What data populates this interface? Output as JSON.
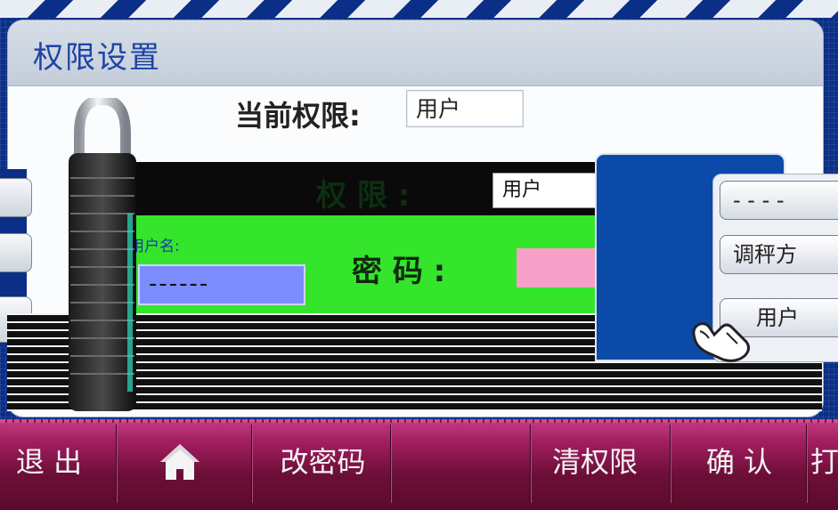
{
  "dialog": {
    "title": "权限设置",
    "current_permission_label": "当前权限:",
    "current_permission_value": "用户"
  },
  "login_panel": {
    "username_label": "用户名:",
    "username_value": "------",
    "role_label": "权  限 :",
    "role_value": "用户",
    "password_label": "密  码 :",
    "password_value": ""
  },
  "right_menu": {
    "items": [
      "- - - -",
      "调秤方",
      "用户"
    ]
  },
  "toolbar": {
    "exit": "退 出",
    "change_password": "改密码",
    "clear_permission": "清权限",
    "confirm": "确 认",
    "partial": "打"
  },
  "icons": {
    "home": "home-icon",
    "lock": "padlock-icon",
    "hand": "hand-pointer-icon"
  },
  "colors": {
    "background": "#0b2f86",
    "title": "#1e43a4",
    "toolbar": "#a21e60",
    "panel_green": "#35e52c",
    "username_field": "#7b8cff",
    "password_field": "#f6a0c8"
  }
}
